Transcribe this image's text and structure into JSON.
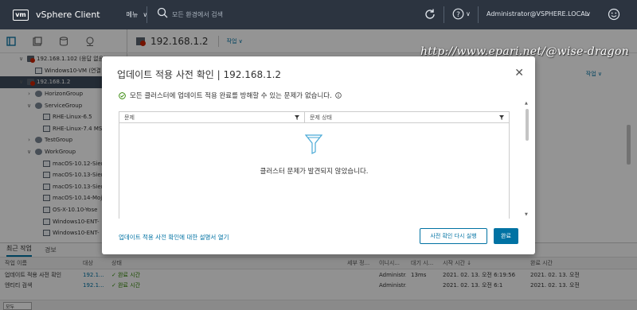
{
  "header": {
    "logo": "vm",
    "app_title": "vSphere Client",
    "menu_label": "메뉴",
    "search_placeholder": "모든 환경에서 검색",
    "user": "Administrator@VSPHERE.LOCAL"
  },
  "tree": [
    {
      "label": "192.168.1.102 (응답 없음)",
      "level": 1,
      "icon": "host-alert-icon",
      "expanded": true
    },
    {
      "label": "Windows10-VM (연결",
      "level": 2,
      "icon": "vm-icon"
    },
    {
      "label": "192.168.1.2",
      "level": 1,
      "icon": "host-alert-icon",
      "expanded": true,
      "selected": true
    },
    {
      "label": "HorizonGroup",
      "level": 2,
      "icon": "resource-pool-icon",
      "expanded": false
    },
    {
      "label": "ServiceGroup",
      "level": 2,
      "icon": "resource-pool-icon",
      "expanded": true
    },
    {
      "label": "RHE-Linux-6.5",
      "level": 3,
      "icon": "vm-icon"
    },
    {
      "label": "RHE-Linux-7.4 MS",
      "level": 3,
      "icon": "vm-icon"
    },
    {
      "label": "TestGroup",
      "level": 2,
      "icon": "resource-pool-icon",
      "expanded": false
    },
    {
      "label": "WorkGroup",
      "level": 2,
      "icon": "resource-pool-icon",
      "expanded": true
    },
    {
      "label": "macOS-10.12-Sier",
      "level": 3,
      "icon": "vm-icon"
    },
    {
      "label": "macOS-10.13-Sier",
      "level": 3,
      "icon": "vm-icon"
    },
    {
      "label": "macOS-10.13-Sier",
      "level": 3,
      "icon": "vm-icon"
    },
    {
      "label": "macOS-10.14-Moj",
      "level": 3,
      "icon": "vm-icon"
    },
    {
      "label": "OS-X-10.10-Yose",
      "level": 3,
      "icon": "vm-icon"
    },
    {
      "label": "Windows10-ENT-",
      "level": 3,
      "icon": "vm-icon"
    },
    {
      "label": "Windows10-ENT-",
      "level": 3,
      "icon": "vm-icon"
    }
  ],
  "main": {
    "title": "192.168.1.2",
    "action_label": "작업 ∨",
    "right_link": "작업 ∨"
  },
  "modal": {
    "title": "업데이트 적용 사전 확인 | 192.168.1.2",
    "status_text": "모든 클러스터에 업데이트 적용 완료를 방해할 수 있는 문제가 없습니다.",
    "columns": [
      "문제",
      "문제 상태"
    ],
    "empty_text": "클러스터 문제가 발견되지 않았습니다.",
    "link_text": "업데이트 적용 사전 확인에 대한 설명서 열기",
    "btn_recheck": "사전 확인 다시 실행",
    "btn_done": "완료"
  },
  "bottom": {
    "tabs": [
      "최근 작업",
      "경보"
    ],
    "columns": [
      "작업 이름",
      "대상",
      "상태",
      "세부 정...",
      "이니시...",
      "대기 시...",
      "시작 시간 ↓",
      "완료 시간"
    ],
    "rows": [
      [
        "업데이트 적용 사전 확인",
        "192.1...",
        "✓ 완료 시간",
        "",
        "Administr...",
        "13ms",
        "2021. 02. 13. 오전 6:19:56",
        "2021. 02. 13. 오전"
      ],
      [
        "엔티티 검색",
        "192.1...",
        "✓ 완료 시간",
        "",
        "Administr...",
        "",
        "2021. 02. 13. 오전 6:1",
        "2021. 02. 13. 오전"
      ]
    ],
    "page_select": "모두"
  },
  "watermark": "http://www.epari.net/@wise-dragon",
  "colors": {
    "topbar": "#2c3440",
    "accent": "#0072a3",
    "alert": "#c92100",
    "success": "#2f8400"
  }
}
